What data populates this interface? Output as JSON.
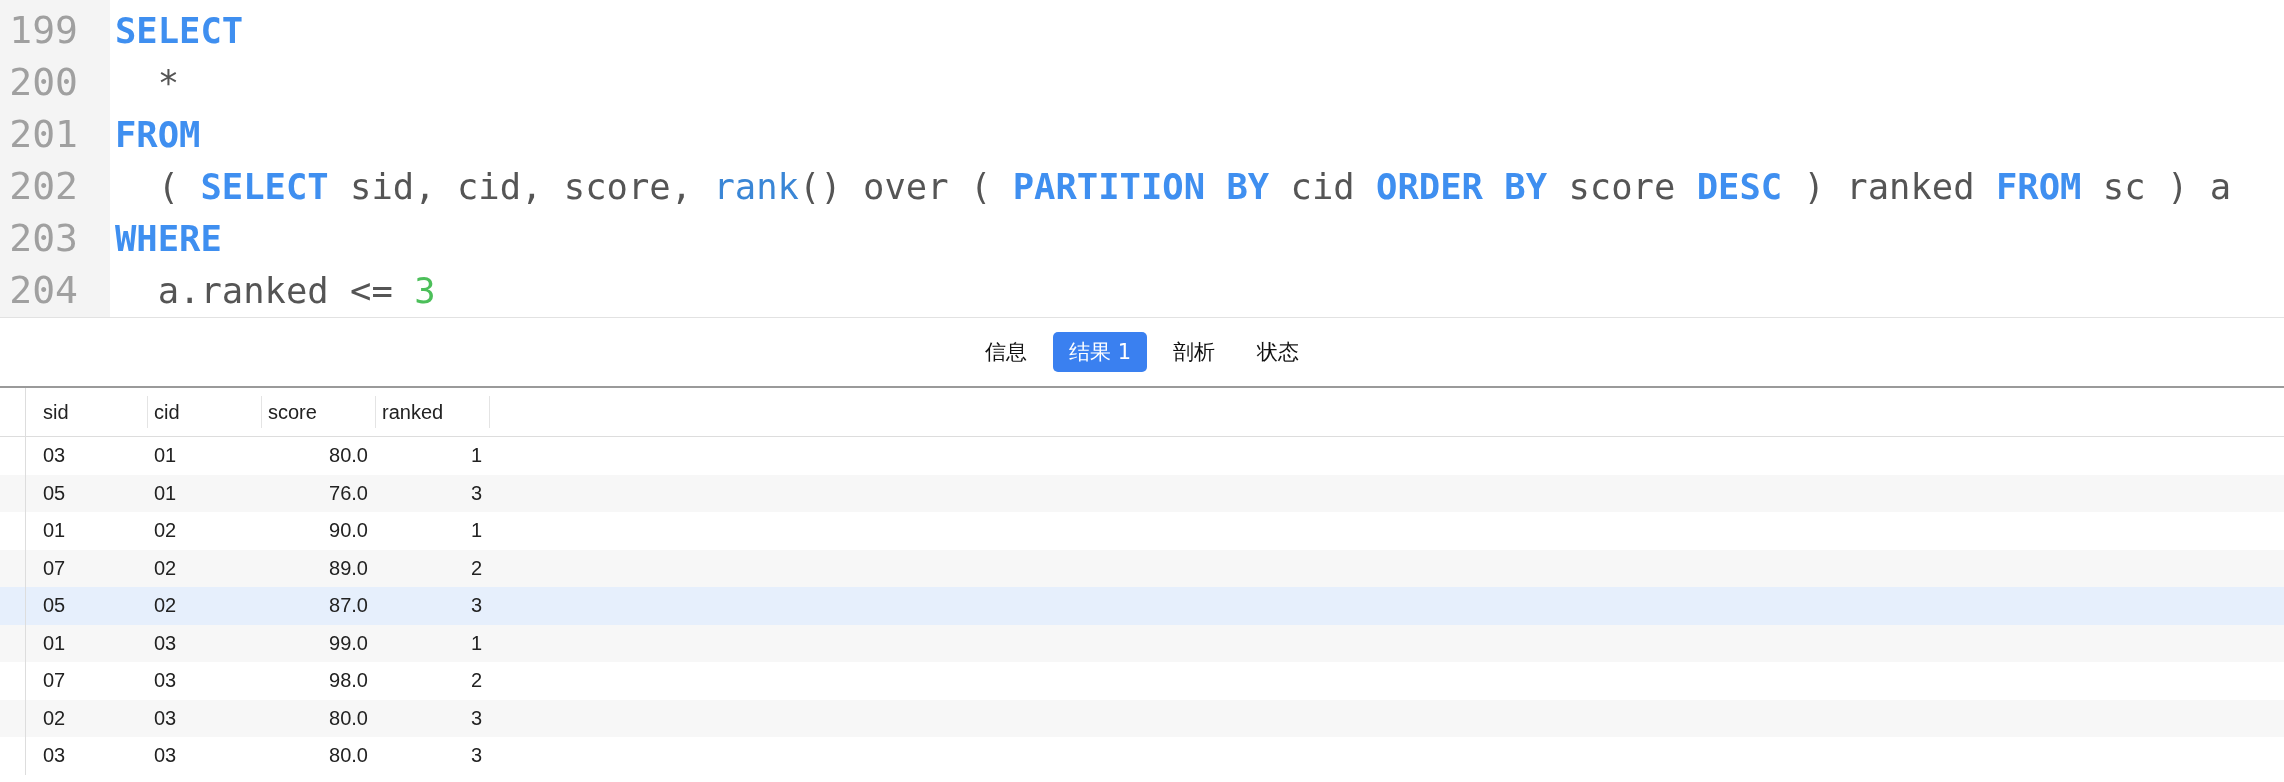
{
  "editor": {
    "lines": [
      {
        "number": "199",
        "tokens": [
          {
            "kind": "keyword",
            "text": "SELECT"
          }
        ]
      },
      {
        "number": "200",
        "tokens": [
          {
            "kind": "plain",
            "text": "  *"
          }
        ]
      },
      {
        "number": "201",
        "tokens": [
          {
            "kind": "keyword",
            "text": "FROM"
          }
        ]
      },
      {
        "number": "202",
        "tokens": [
          {
            "kind": "plain",
            "text": "  ( "
          },
          {
            "kind": "keyword",
            "text": "SELECT"
          },
          {
            "kind": "plain",
            "text": " sid, cid, score, "
          },
          {
            "kind": "function",
            "text": "rank"
          },
          {
            "kind": "plain",
            "text": "() over ( "
          },
          {
            "kind": "keyword",
            "text": "PARTITION BY"
          },
          {
            "kind": "plain",
            "text": " cid "
          },
          {
            "kind": "keyword",
            "text": "ORDER BY"
          },
          {
            "kind": "plain",
            "text": " score "
          },
          {
            "kind": "keyword",
            "text": "DESC"
          },
          {
            "kind": "plain",
            "text": " ) ranked "
          },
          {
            "kind": "keyword",
            "text": "FROM"
          },
          {
            "kind": "plain",
            "text": " sc ) a"
          }
        ]
      },
      {
        "number": "203",
        "tokens": [
          {
            "kind": "keyword",
            "text": "WHERE"
          }
        ]
      },
      {
        "number": "204",
        "tokens": [
          {
            "kind": "plain",
            "text": "  a.ranked <= "
          },
          {
            "kind": "number",
            "text": "3"
          }
        ]
      }
    ]
  },
  "tabs": [
    {
      "label": "信息",
      "selected": false
    },
    {
      "label": "结果 1",
      "selected": true
    },
    {
      "label": "剖析",
      "selected": false
    },
    {
      "label": "状态",
      "selected": false
    }
  ],
  "table": {
    "columns": [
      {
        "label": "sid"
      },
      {
        "label": "cid"
      },
      {
        "label": "score"
      },
      {
        "label": "ranked"
      }
    ],
    "rows": [
      {
        "cells": [
          "03",
          "01",
          "80.0",
          "1"
        ],
        "selected": false
      },
      {
        "cells": [
          "05",
          "01",
          "76.0",
          "3"
        ],
        "selected": false
      },
      {
        "cells": [
          "01",
          "02",
          "90.0",
          "1"
        ],
        "selected": false
      },
      {
        "cells": [
          "07",
          "02",
          "89.0",
          "2"
        ],
        "selected": false
      },
      {
        "cells": [
          "05",
          "02",
          "87.0",
          "3"
        ],
        "selected": true
      },
      {
        "cells": [
          "01",
          "03",
          "99.0",
          "1"
        ],
        "selected": false
      },
      {
        "cells": [
          "07",
          "03",
          "98.0",
          "2"
        ],
        "selected": false
      },
      {
        "cells": [
          "02",
          "03",
          "80.0",
          "3"
        ],
        "selected": false
      },
      {
        "cells": [
          "03",
          "03",
          "80.0",
          "3"
        ],
        "selected": false
      }
    ]
  }
}
